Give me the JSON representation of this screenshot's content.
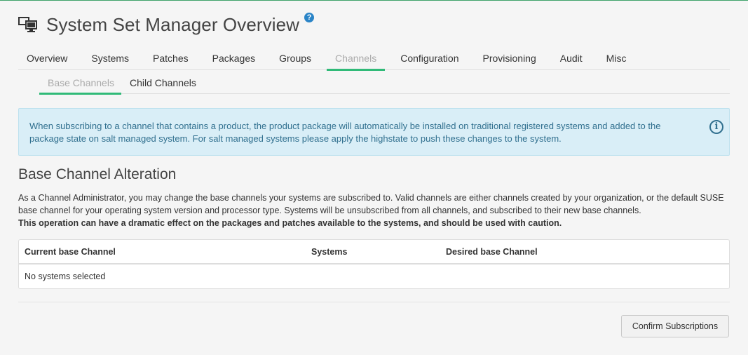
{
  "page": {
    "title": "System Set Manager Overview",
    "help_icon": "?",
    "title_icon": "system-set-icon"
  },
  "tabs": [
    {
      "label": "Overview"
    },
    {
      "label": "Systems"
    },
    {
      "label": "Patches"
    },
    {
      "label": "Packages"
    },
    {
      "label": "Groups"
    },
    {
      "label": "Channels",
      "active": true
    },
    {
      "label": "Configuration"
    },
    {
      "label": "Provisioning"
    },
    {
      "label": "Audit"
    },
    {
      "label": "Misc"
    }
  ],
  "subtabs": [
    {
      "label": "Base Channels",
      "active": true
    },
    {
      "label": "Child Channels"
    }
  ],
  "alert": {
    "text": "When subscribing to a channel that contains a product, the product package will automatically be installed on traditional registered systems and added to the package state on salt managed system. For salt managed systems please apply the highstate to push these changes to the system.",
    "icon": "i"
  },
  "section": {
    "title": "Base Channel Alteration",
    "description": "As a Channel Administrator, you may change the base channels your systems are subscribed to. Valid channels are either channels created by your organization, or the default SUSE base channel for your operating system version and processor type. Systems will be unsubscribed from all channels, and subscribed to their new base channels.",
    "warning": "This operation can have a dramatic effect on the packages and patches available to the systems, and should be used with caution."
  },
  "table": {
    "columns": [
      "Current base Channel",
      "Systems",
      "Desired base Channel"
    ],
    "empty_text": "No systems selected"
  },
  "actions": {
    "confirm_label": "Confirm Subscriptions"
  },
  "colors": {
    "accent": "#30ba78",
    "info_bg": "#d9eef7",
    "info_text": "#31708f"
  }
}
